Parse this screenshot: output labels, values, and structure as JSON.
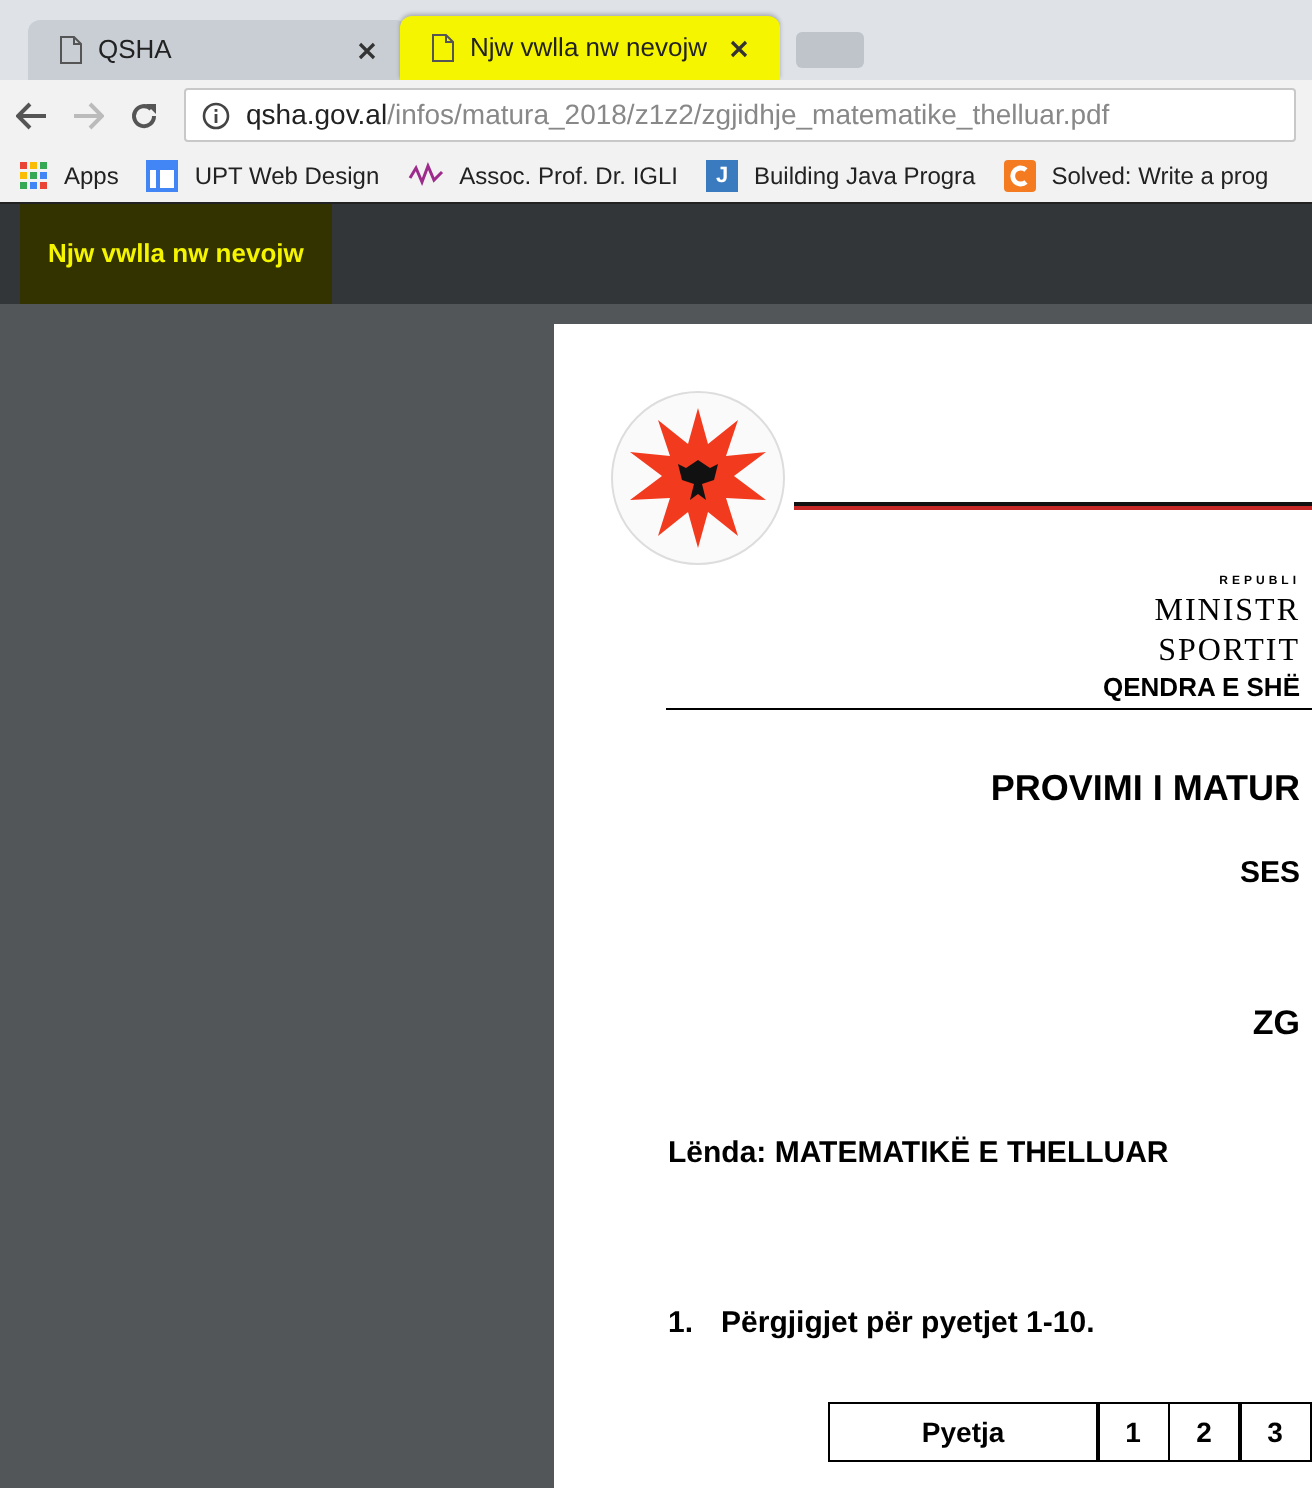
{
  "tabs": [
    {
      "title": "QSHA",
      "selected": false,
      "highlighted": false
    },
    {
      "title": "Njw vwlla nw nevojw",
      "selected": true,
      "highlighted": true
    }
  ],
  "address_bar": {
    "domain": "qsha.gov.al",
    "path": "/infos/matura_2018/z1z2/zgjidhje_matematike_thelluar.pdf"
  },
  "bookmarks": [
    {
      "label": "Apps",
      "kind": "apps"
    },
    {
      "label": "UPT Web Design",
      "kind": "page"
    },
    {
      "label": "Assoc. Prof. Dr. IGLI",
      "kind": "logo"
    },
    {
      "label": "Building Java Progra",
      "kind": "j",
      "icon_glyph": "J"
    },
    {
      "label": "Solved: Write a prog",
      "kind": "c"
    }
  ],
  "pdf_toolbar": {
    "title": "Njw vwlla nw nevojw",
    "highlighted": true
  },
  "document": {
    "header_republic": "REPUBLI",
    "header_ministry_1": "MINISTR",
    "header_ministry_2": "SPORTIT",
    "header_centre": "QENDRA E SHË",
    "title": "PROVIMI I MATUR",
    "session": "SES",
    "heading": "ZG",
    "subject": "Lënda: MATEMATIKË E THELLUAR",
    "section_number": "1.",
    "section_title": "Përgjigjet për pyetjet 1-10.",
    "table": {
      "columns": [
        "Pyetja",
        "1",
        "2",
        "3"
      ]
    }
  }
}
